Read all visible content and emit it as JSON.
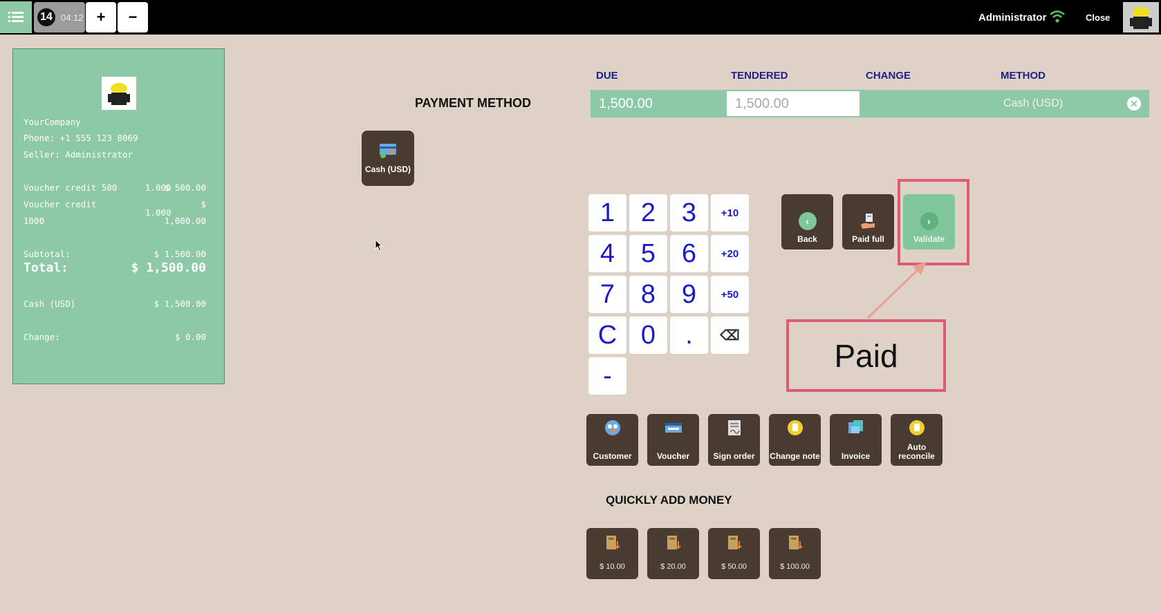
{
  "topbar": {
    "order_number": "14",
    "order_time": "04:12",
    "plus_label": "+",
    "minus_label": "−",
    "user": "Administrator",
    "close_label": "Close"
  },
  "receipt": {
    "company": "YourCompany",
    "phone": "Phone: +1 555 123 8069",
    "seller": "Seller: Administrator",
    "lines": [
      {
        "name": "Voucher credit 500",
        "qty": "1.000",
        "price": "$ 500.00"
      },
      {
        "name_1": "Voucher credit",
        "name_2": "1000",
        "qty": "1.000",
        "price_1": "$",
        "price_2": "1,000.00"
      }
    ],
    "subtotal_label": "Subtotal:",
    "subtotal_value": "$ 1,500.00",
    "total_label": "Total:",
    "total_value": "$ 1,500.00",
    "payment_label": "Cash (USD)",
    "payment_value": "$ 1,500.00",
    "change_label": "Change:",
    "change_value": "$ 0.00"
  },
  "payment": {
    "title": "PAYMENT METHOD",
    "method_button": "Cash (USD)",
    "columns": [
      "DUE",
      "TENDERED",
      "CHANGE",
      "METHOD"
    ],
    "line": {
      "due": "1,500.00",
      "tendered": "1,500.00",
      "change": "",
      "method": "Cash (USD)"
    }
  },
  "numpad": {
    "keys": [
      "1",
      "2",
      "3",
      "+10",
      "4",
      "5",
      "6",
      "+20",
      "7",
      "8",
      "9",
      "+50",
      "C",
      "0",
      ".",
      "⌫",
      "-"
    ]
  },
  "actions": {
    "back": "Back",
    "paid_full": "Paid full",
    "validate": "Validate",
    "annotation": "Paid"
  },
  "options": [
    "Customer",
    "Voucher",
    "Sign order",
    "Change note",
    "Invoice",
    "Auto reconcile"
  ],
  "quick_money": {
    "title": "QUICKLY ADD MONEY",
    "amounts": [
      "$ 10.00",
      "$ 20.00",
      "$ 50.00",
      "$ 100.00"
    ]
  },
  "colors": {
    "accent_green": "#8ec9a7",
    "button_brown": "#4a3b30",
    "highlight_pink": "#e05a75",
    "numpad_blue": "#1a1acc"
  }
}
